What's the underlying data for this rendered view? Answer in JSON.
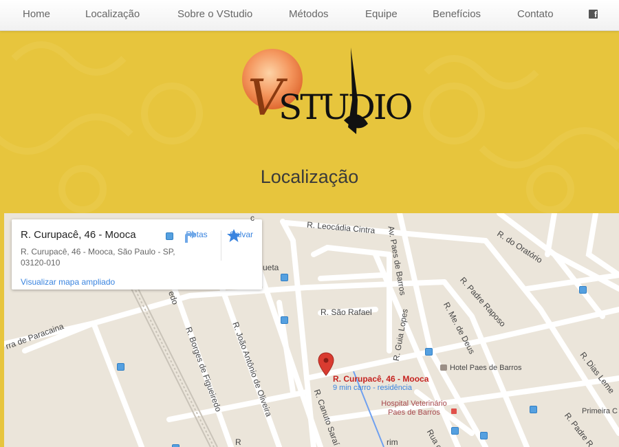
{
  "nav": {
    "items": [
      {
        "label": "Home"
      },
      {
        "label": "Localização"
      },
      {
        "label": "Sobre o VStudio"
      },
      {
        "label": "Métodos"
      },
      {
        "label": "Equipe"
      },
      {
        "label": "Benefícios"
      },
      {
        "label": "Contato"
      }
    ],
    "facebook_icon": "facebook-icon"
  },
  "hero": {
    "logo_letter": "V",
    "logo_text": "STUDIO",
    "title": "Localização",
    "background_color": "#e7c53d"
  },
  "map": {
    "card": {
      "title": "R. Curupacê, 46 - Mooca",
      "address": "R. Curupacê, 46 - Mooca, São Paulo - SP, 03120-010",
      "view_larger_link": "Visualizar mapa ampliado",
      "directions_label": "Rotas",
      "save_label": "Salvar"
    },
    "pin": {
      "label": "R. Curupacê, 46 - Mooca",
      "sublabel": "9 min carro - residência"
    },
    "streets": {
      "leocadia": "R. Leocádia Cintra",
      "paes_barros": "Av. Paes de Barros",
      "oratorio": "R. do Oratório",
      "padre_raposo": "R. Padre Raposo",
      "sao_rafael": "R. São Rafael",
      "guia_lopes": "R. Guia Lopes",
      "me_deus": "R. Me. de Deus",
      "dias_leme": "R. Dias Leme",
      "paracaina": "rra de Paracaina",
      "borges": "R. Borges de Figueiredo",
      "joao_antonio": "R. João Antônio de Oliveira",
      "canuto": "R. Canuto Saraí",
      "padre_r": "R. Padre R",
      "rua_c": "Rua c",
      "ueta": "ueta",
      "edo": "edo",
      "c": "c",
      "r": "R",
      "rim": "rim"
    },
    "pois": {
      "hotel": "Hotel Paes de Barros",
      "hospital": "Hospital Veterinário Paes de Barros",
      "primeira": "Primeira C"
    },
    "colors": {
      "map_bg": "#ebe5da",
      "road": "#ffffff",
      "pin": "#d93b30",
      "link": "#3a84df"
    }
  }
}
